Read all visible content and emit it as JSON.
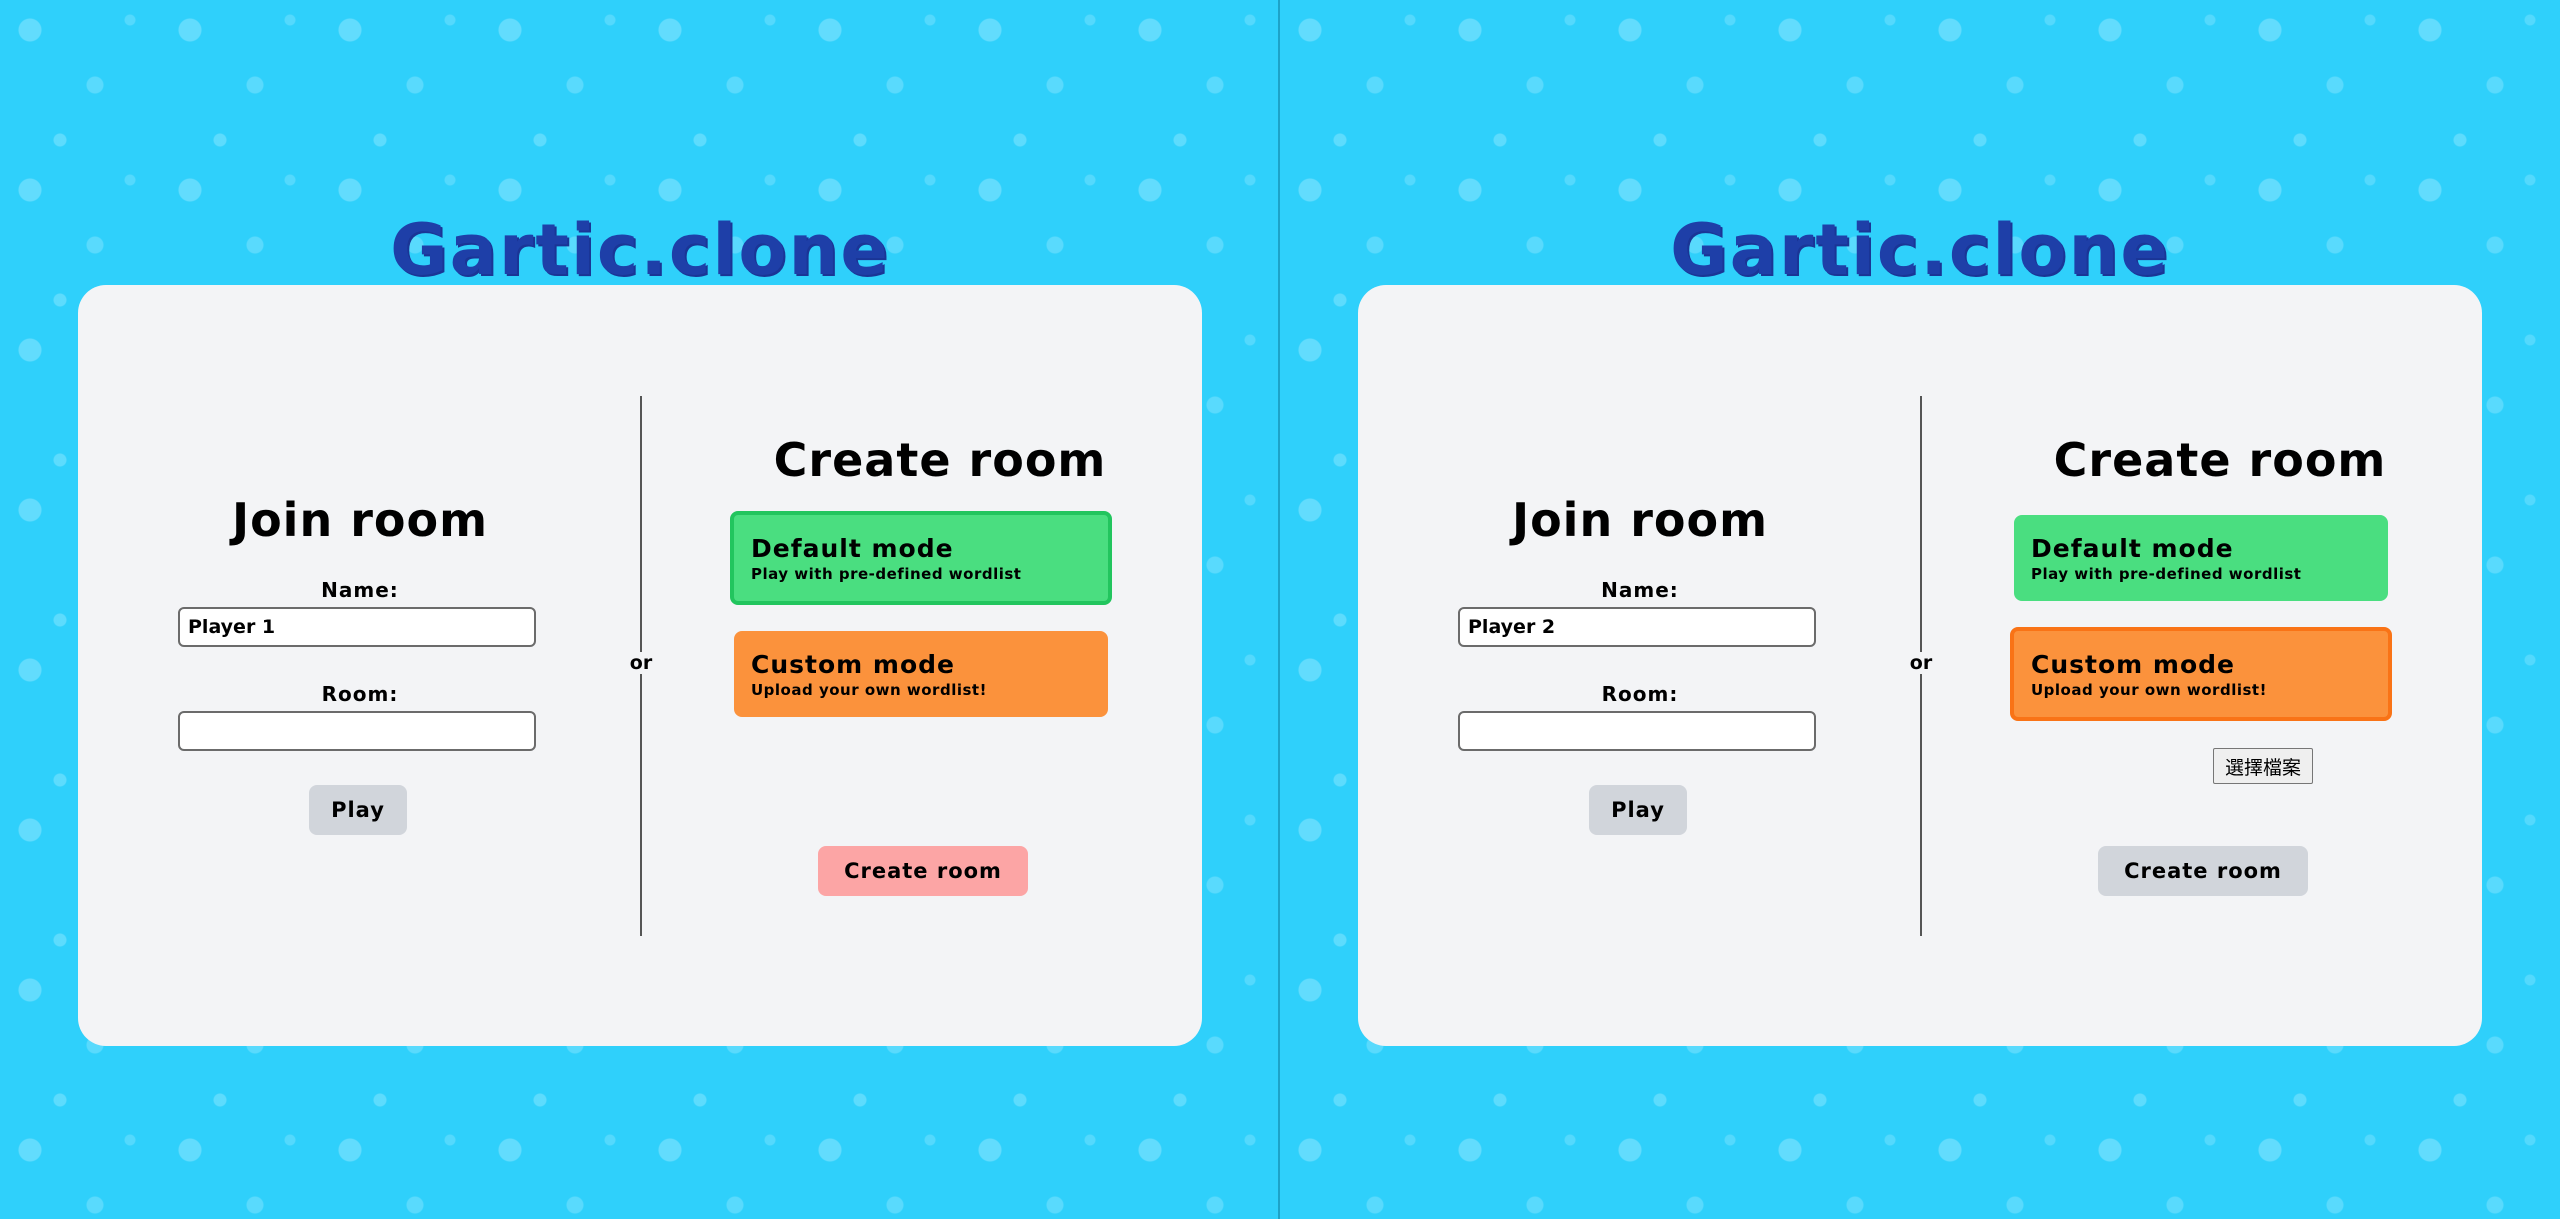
{
  "app": {
    "logo": "Gartic.clone"
  },
  "panes": [
    {
      "join": {
        "title": "Join room",
        "name_label": "Name:",
        "name_value": "Player 1",
        "room_label": "Room:",
        "room_value": "",
        "play_label": "Play"
      },
      "or_label": "or",
      "create": {
        "title": "Create room",
        "default_title": "Default mode",
        "default_desc": "Play with pre-defined wordlist",
        "custom_title": "Custom mode",
        "custom_desc": "Upload your own wordlist!",
        "selected_mode": "default",
        "create_label": "Create room",
        "create_enabled": false
      }
    },
    {
      "join": {
        "title": "Join room",
        "name_label": "Name:",
        "name_value": "Player 2",
        "room_label": "Room:",
        "room_value": "",
        "play_label": "Play"
      },
      "or_label": "or",
      "create": {
        "title": "Create room",
        "default_title": "Default mode",
        "default_desc": "Play with pre-defined wordlist",
        "custom_title": "Custom mode",
        "custom_desc": "Upload your own wordlist!",
        "selected_mode": "custom",
        "file_button_label": "選擇檔案",
        "create_label": "Create room",
        "create_enabled": true
      }
    }
  ],
  "colors": {
    "background": "#2fd0fb",
    "logo": "#1e3fa8",
    "card": "#f3f4f6",
    "default_mode": "#4ade80",
    "custom_mode": "#fb923c",
    "create_disabled": "#fca5a5",
    "button_gray": "#d1d5db"
  }
}
